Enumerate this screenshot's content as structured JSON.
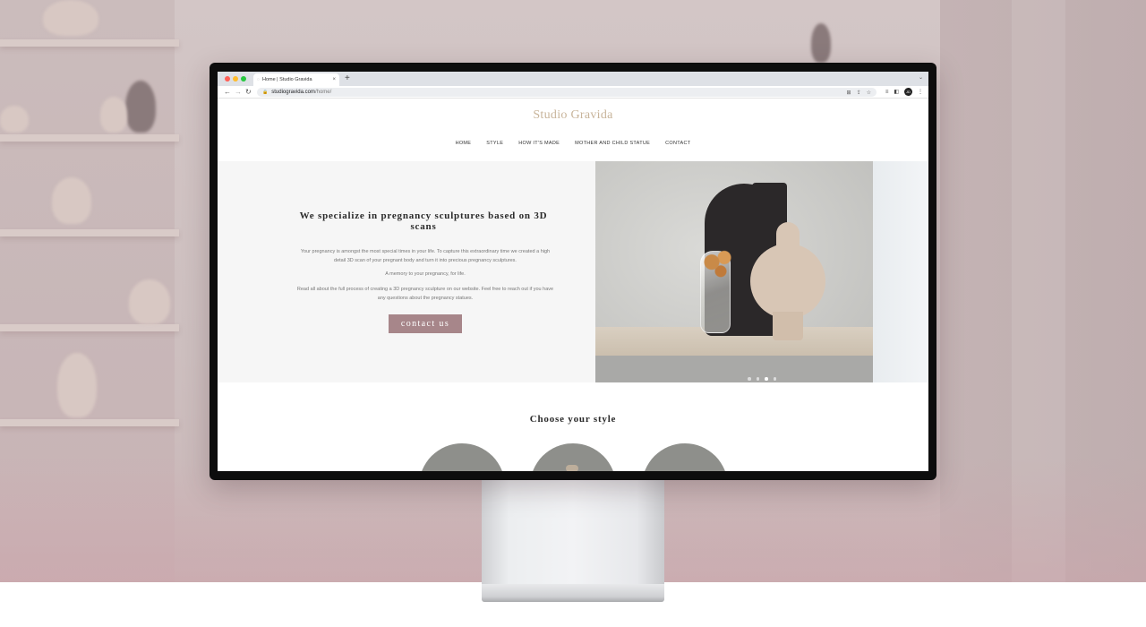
{
  "browser": {
    "tab_title": "Home | Studio Gravida",
    "tab_close": "×",
    "new_tab": "+",
    "tab_menu": "⌄",
    "back": "←",
    "forward": "→",
    "reload": "↻",
    "url_domain": "studiogravida.com",
    "url_path": "/home/",
    "profile_initials": "JD"
  },
  "site": {
    "logo": "Studio Gravida",
    "nav": [
      "HOME",
      "STYLE",
      "HOW IT'S MADE",
      "MOTHER AND CHILD STATUE",
      "CONTACT"
    ],
    "hero": {
      "heading": "We specialize in pregnancy sculptures based on 3D scans",
      "paragraph_1": "Your pregnancy is amongst the most special times in your life. To capture this extraordinary time we created a high detail 3D scan of your pregnant body and turn it into precious pregnancy sculptures.",
      "paragraph_2": "A memory to your pregnancy, for life.",
      "paragraph_3": "Read all about the full process of creating a 3D pregnancy sculpture on our website. Feel free to reach out if you have any questions about the pregnancy statues.",
      "cta": "contact us"
    },
    "slider": {
      "slide_count": 4,
      "active_index": 2
    },
    "choose_title": "Choose your style"
  },
  "colors": {
    "logo": "#c8b49a",
    "cta_background": "#a7868a",
    "hero_panel": "#f6f6f6"
  },
  "icons": [
    "lock-icon",
    "translate-icon",
    "share-icon",
    "star-icon",
    "extensions-icon",
    "sidebar-icon",
    "menu-icon"
  ]
}
